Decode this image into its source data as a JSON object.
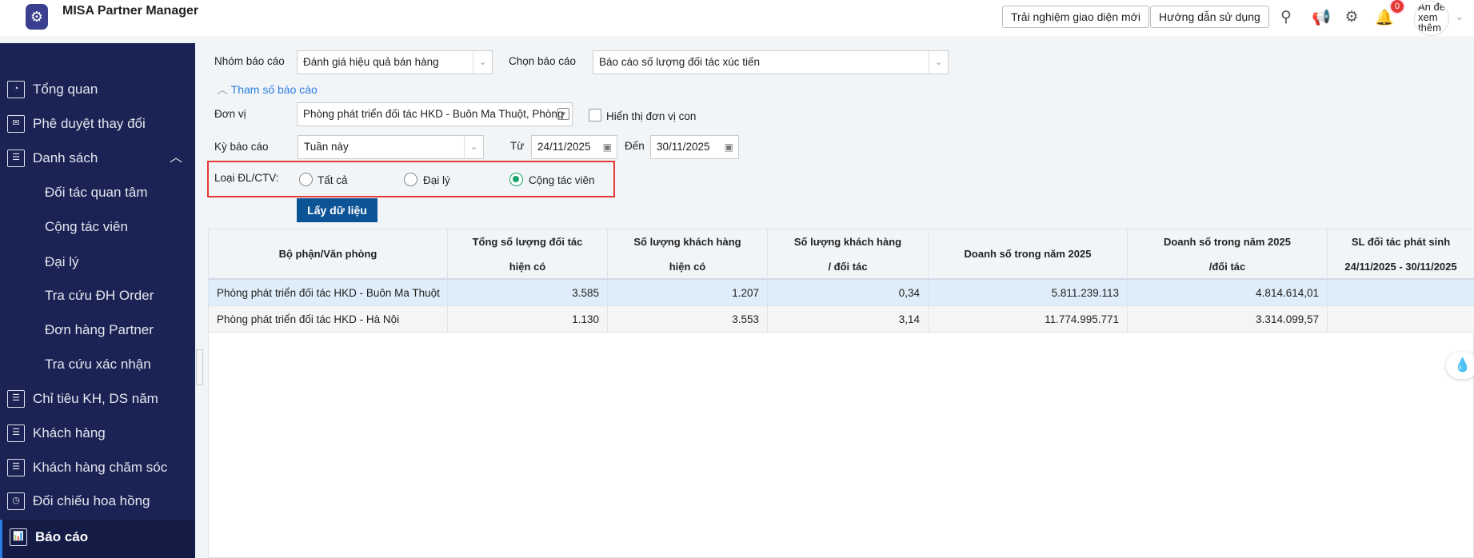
{
  "header": {
    "title": "MISA Partner Manager",
    "btn_new_ui": "Trải nghiệm giao diện mới",
    "btn_guide": "Hướng dẫn sử dụng",
    "notif_count": "0",
    "avatar_text": "Ẩn để xem thêm"
  },
  "sidebar": {
    "items": [
      {
        "label": "Tổng quan",
        "icon": "dashboard-icon"
      },
      {
        "label": "Phê duyệt thay đổi",
        "icon": "mail-icon"
      },
      {
        "label": "Danh sách",
        "icon": "list-icon"
      },
      {
        "label": "Đối tác quan tâm"
      },
      {
        "label": "Cộng tác viên"
      },
      {
        "label": "Đại lý"
      },
      {
        "label": "Tra cứu ĐH Order"
      },
      {
        "label": "Đơn hàng Partner"
      },
      {
        "label": "Tra cứu xác nhận"
      },
      {
        "label": "Chỉ tiêu KH, DS năm",
        "icon": "list-icon"
      },
      {
        "label": "Khách hàng",
        "icon": "list-icon"
      },
      {
        "label": "Khách hàng chăm sóc",
        "icon": "list-icon"
      },
      {
        "label": "Đối chiếu hoa hồng",
        "icon": "clock-icon"
      },
      {
        "label": "Báo cáo",
        "icon": "report-icon",
        "active": true
      }
    ]
  },
  "form": {
    "group_label": "Nhóm báo cáo",
    "group_value": "Đánh giá hiệu quả bán hàng",
    "report_label": "Chọn báo cáo",
    "report_value": "Báo cáo số lượng đối tác xúc tiến",
    "params_toggle": "Tham số báo cáo",
    "unit_label": "Đơn vị",
    "unit_value": "Phòng phát triển đối tác HKD - Buôn Ma Thuột, Phòng",
    "show_child_label": "Hiển thị đơn vị con",
    "period_label": "Kỳ báo cáo",
    "period_value": "Tuần này",
    "from_label": "Từ",
    "from_value": "24/11/2025",
    "to_label": "Đến",
    "to_value": "30/11/2025",
    "type_label": "Loại ĐL/CTV:",
    "type_options": [
      "Tất cả",
      "Đại lý",
      "Cộng tác viên"
    ],
    "type_selected": "Cộng tác viên",
    "fetch_button": "Lấy dữ liệu"
  },
  "table": {
    "headers": [
      [
        "Bộ phận/Văn phòng"
      ],
      [
        "Tổng số lượng đối tác",
        "hiện có"
      ],
      [
        "Số lượng khách hàng",
        "hiện có"
      ],
      [
        "Số lượng khách hàng",
        "/ đối tác"
      ],
      [
        "Doanh số trong năm 2025"
      ],
      [
        "Doanh số trong năm 2025",
        "/đối tác"
      ],
      [
        "SL đối tác phát sinh",
        "24/11/2025 - 30/11/2025"
      ]
    ],
    "rows": [
      [
        "Phòng phát triển đối tác HKD - Buôn Ma Thuột",
        "3.585",
        "1.207",
        "0,34",
        "5.811.239.113",
        "4.814.614,01",
        ""
      ],
      [
        "Phòng phát triển đối tác HKD - Hà Nội",
        "1.130",
        "3.553",
        "3,14",
        "11.774.995.771",
        "3.314.099,57",
        ""
      ]
    ]
  }
}
